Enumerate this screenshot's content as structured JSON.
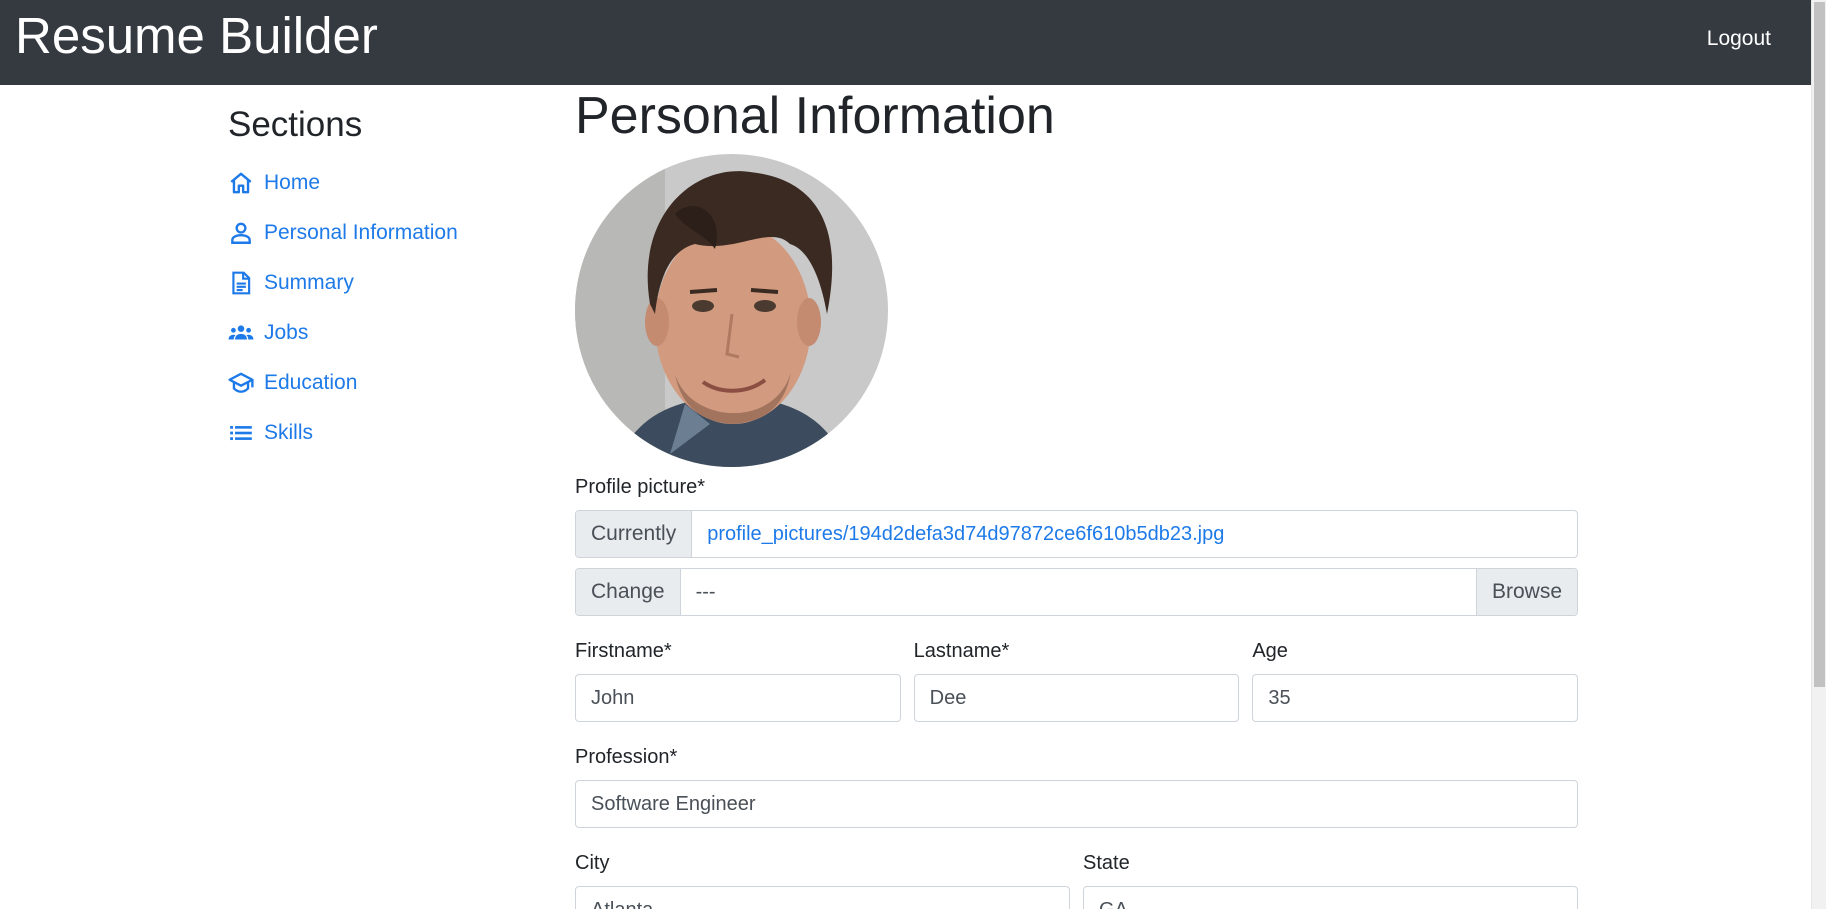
{
  "app": {
    "brand": "Resume Builder",
    "logout": "Logout"
  },
  "sidebar": {
    "title": "Sections",
    "items": [
      {
        "label": "Home",
        "icon": "home-icon"
      },
      {
        "label": "Personal Information",
        "icon": "person-icon"
      },
      {
        "label": "Summary",
        "icon": "document-icon"
      },
      {
        "label": "Jobs",
        "icon": "group-icon"
      },
      {
        "label": "Education",
        "icon": "graduation-cap-icon"
      },
      {
        "label": "Skills",
        "icon": "list-icon"
      }
    ]
  },
  "main": {
    "title": "Personal Information",
    "profile_picture": {
      "label": "Profile picture*",
      "currently_label": "Currently",
      "current_file": "profile_pictures/194d2defa3d74d97872ce6f610b5db23.jpg",
      "change_label": "Change",
      "change_value": "---",
      "browse_label": "Browse"
    },
    "fields": {
      "firstname": {
        "label": "Firstname*",
        "value": "John"
      },
      "lastname": {
        "label": "Lastname*",
        "value": "Dee"
      },
      "age": {
        "label": "Age",
        "value": "35"
      },
      "profession": {
        "label": "Profession*",
        "value": "Software Engineer"
      },
      "city": {
        "label": "City",
        "value": "Atlanta"
      },
      "state": {
        "label": "State",
        "value": "GA"
      }
    }
  },
  "colors": {
    "navbar": "#343a40",
    "link": "#1e7ae8",
    "addon": "#e9ecef",
    "border": "#ced4da"
  }
}
